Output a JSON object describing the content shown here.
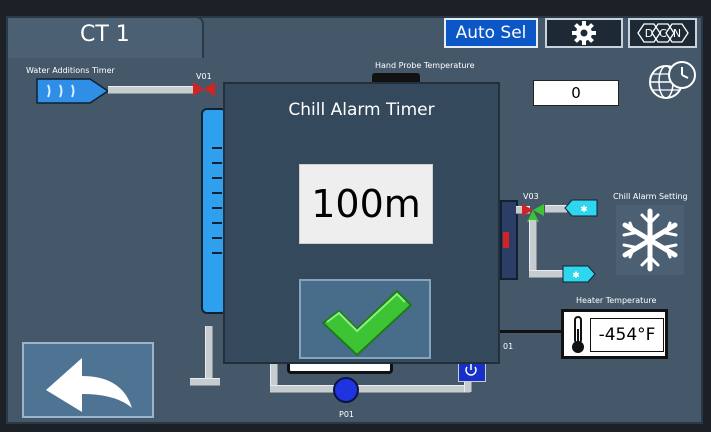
{
  "header": {
    "tab_title": "CT 1",
    "auto_sel_label": "Auto Sel"
  },
  "process": {
    "water_additions_label": "Water Additions Timer",
    "hand_probe_label": "Hand Probe Temperature",
    "valve_v01": "V01",
    "valve_v03": "V03",
    "pump_p01": "P01",
    "counter_value": "0",
    "chill_alarm_setting_label": "Chill Alarm Setting",
    "heater_temp_label": "Heater Temperature",
    "heater_temp_value": "-454°F",
    "partial_label_01": "01"
  },
  "dialog": {
    "title": "Chill Alarm Timer",
    "value": "100m"
  },
  "colors": {
    "accent_blue": "#1f8fe6",
    "check_green": "#3cc434",
    "cyan": "#2fd6ee",
    "valve_red": "#d22222"
  }
}
